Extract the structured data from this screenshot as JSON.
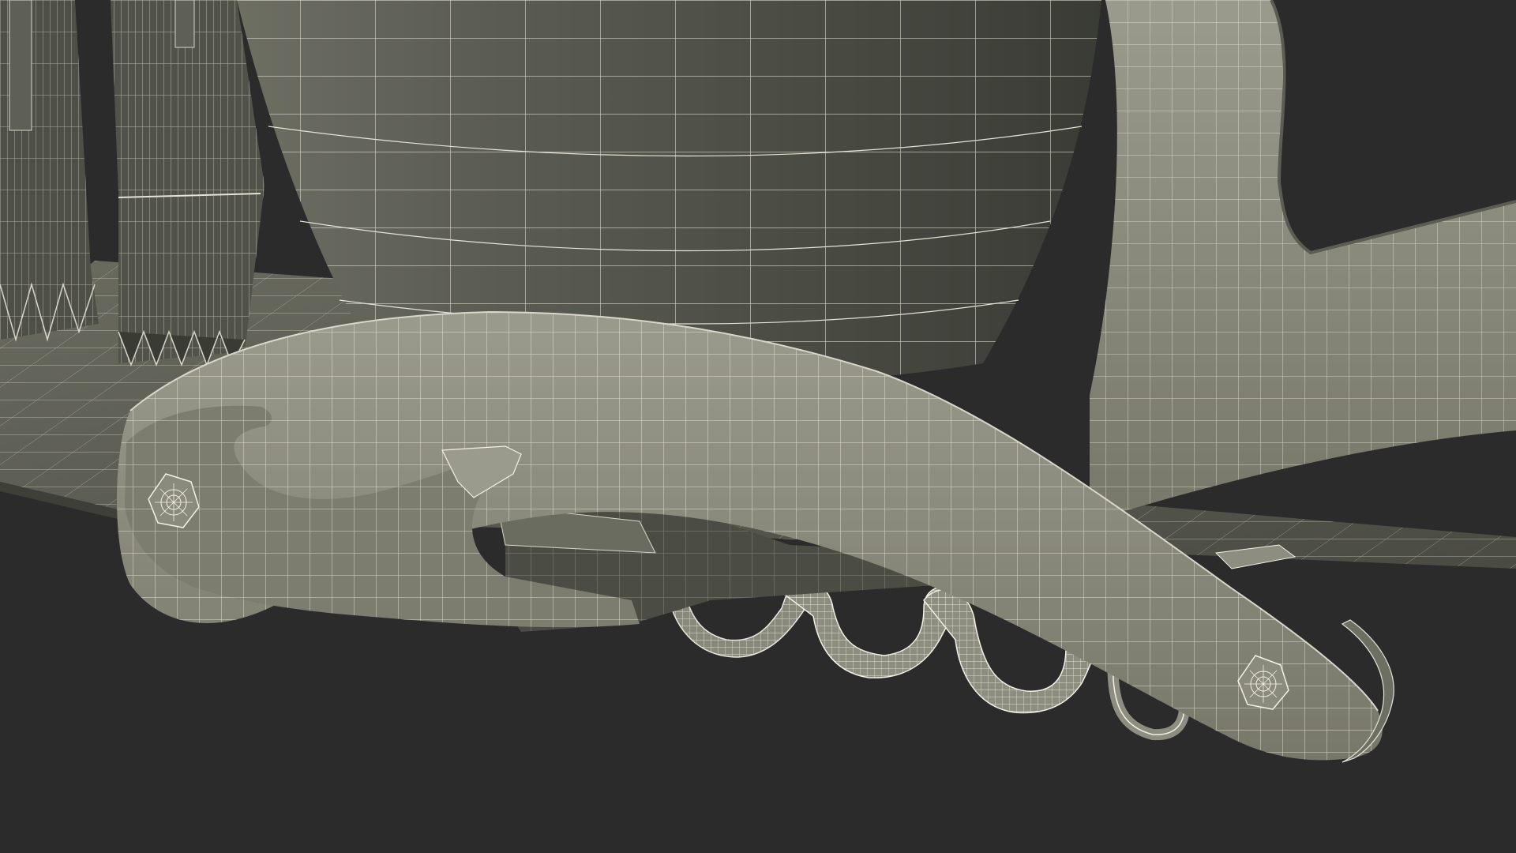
{
  "scene": {
    "background": "#2b2b2b",
    "surface_color": "#868778",
    "surface_shadow": "#5c5d52",
    "wire_color": "#f3f1e6"
  }
}
